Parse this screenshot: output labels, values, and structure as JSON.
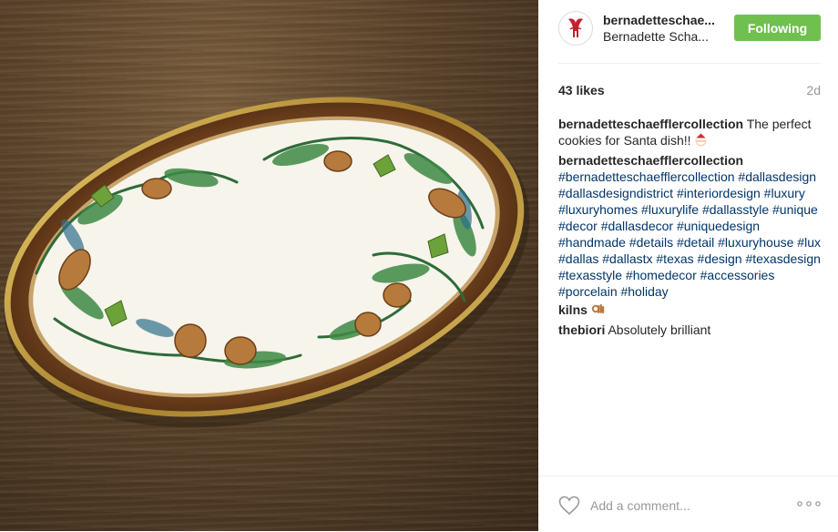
{
  "post": {
    "username": "bernadetteschae...",
    "full_name": "Bernadette Scha...",
    "follow_label": "Following",
    "likes": "43 likes",
    "age": "2d",
    "add_comment_placeholder": "Add a comment..."
  },
  "comments": [
    {
      "user": "bernadetteschaefflercollection",
      "text": " The perfect cookies for Santa dish!!",
      "emoji": "santa-emoji"
    },
    {
      "user": "bernadetteschaefflercollection",
      "text": " #bernadetteschaefflercollection #dallasdesign #dallasdesigndistrict #interiordesign #luxury #luxuryhomes #luxurylife #dallasstyle #unique #decor #dallasdecor #uniquedesign #handmade #details #detail #luxuryhouse #lux #dallas #dallastx #texas #design #texasdesign #texasstyle #homedecor #accessories #porcelain #holiday"
    },
    {
      "user": "kilns",
      "text": " ",
      "emoji": "ok-hand-emoji"
    },
    {
      "user": "thebiori",
      "text": " Absolutely brilliant"
    }
  ],
  "colors": {
    "follow_bg": "#70c050",
    "hashtag": "#003569",
    "muted": "#999999",
    "text": "#262626"
  },
  "icons": [
    "brand-logo-icon",
    "heart-icon",
    "more-options-icon"
  ]
}
